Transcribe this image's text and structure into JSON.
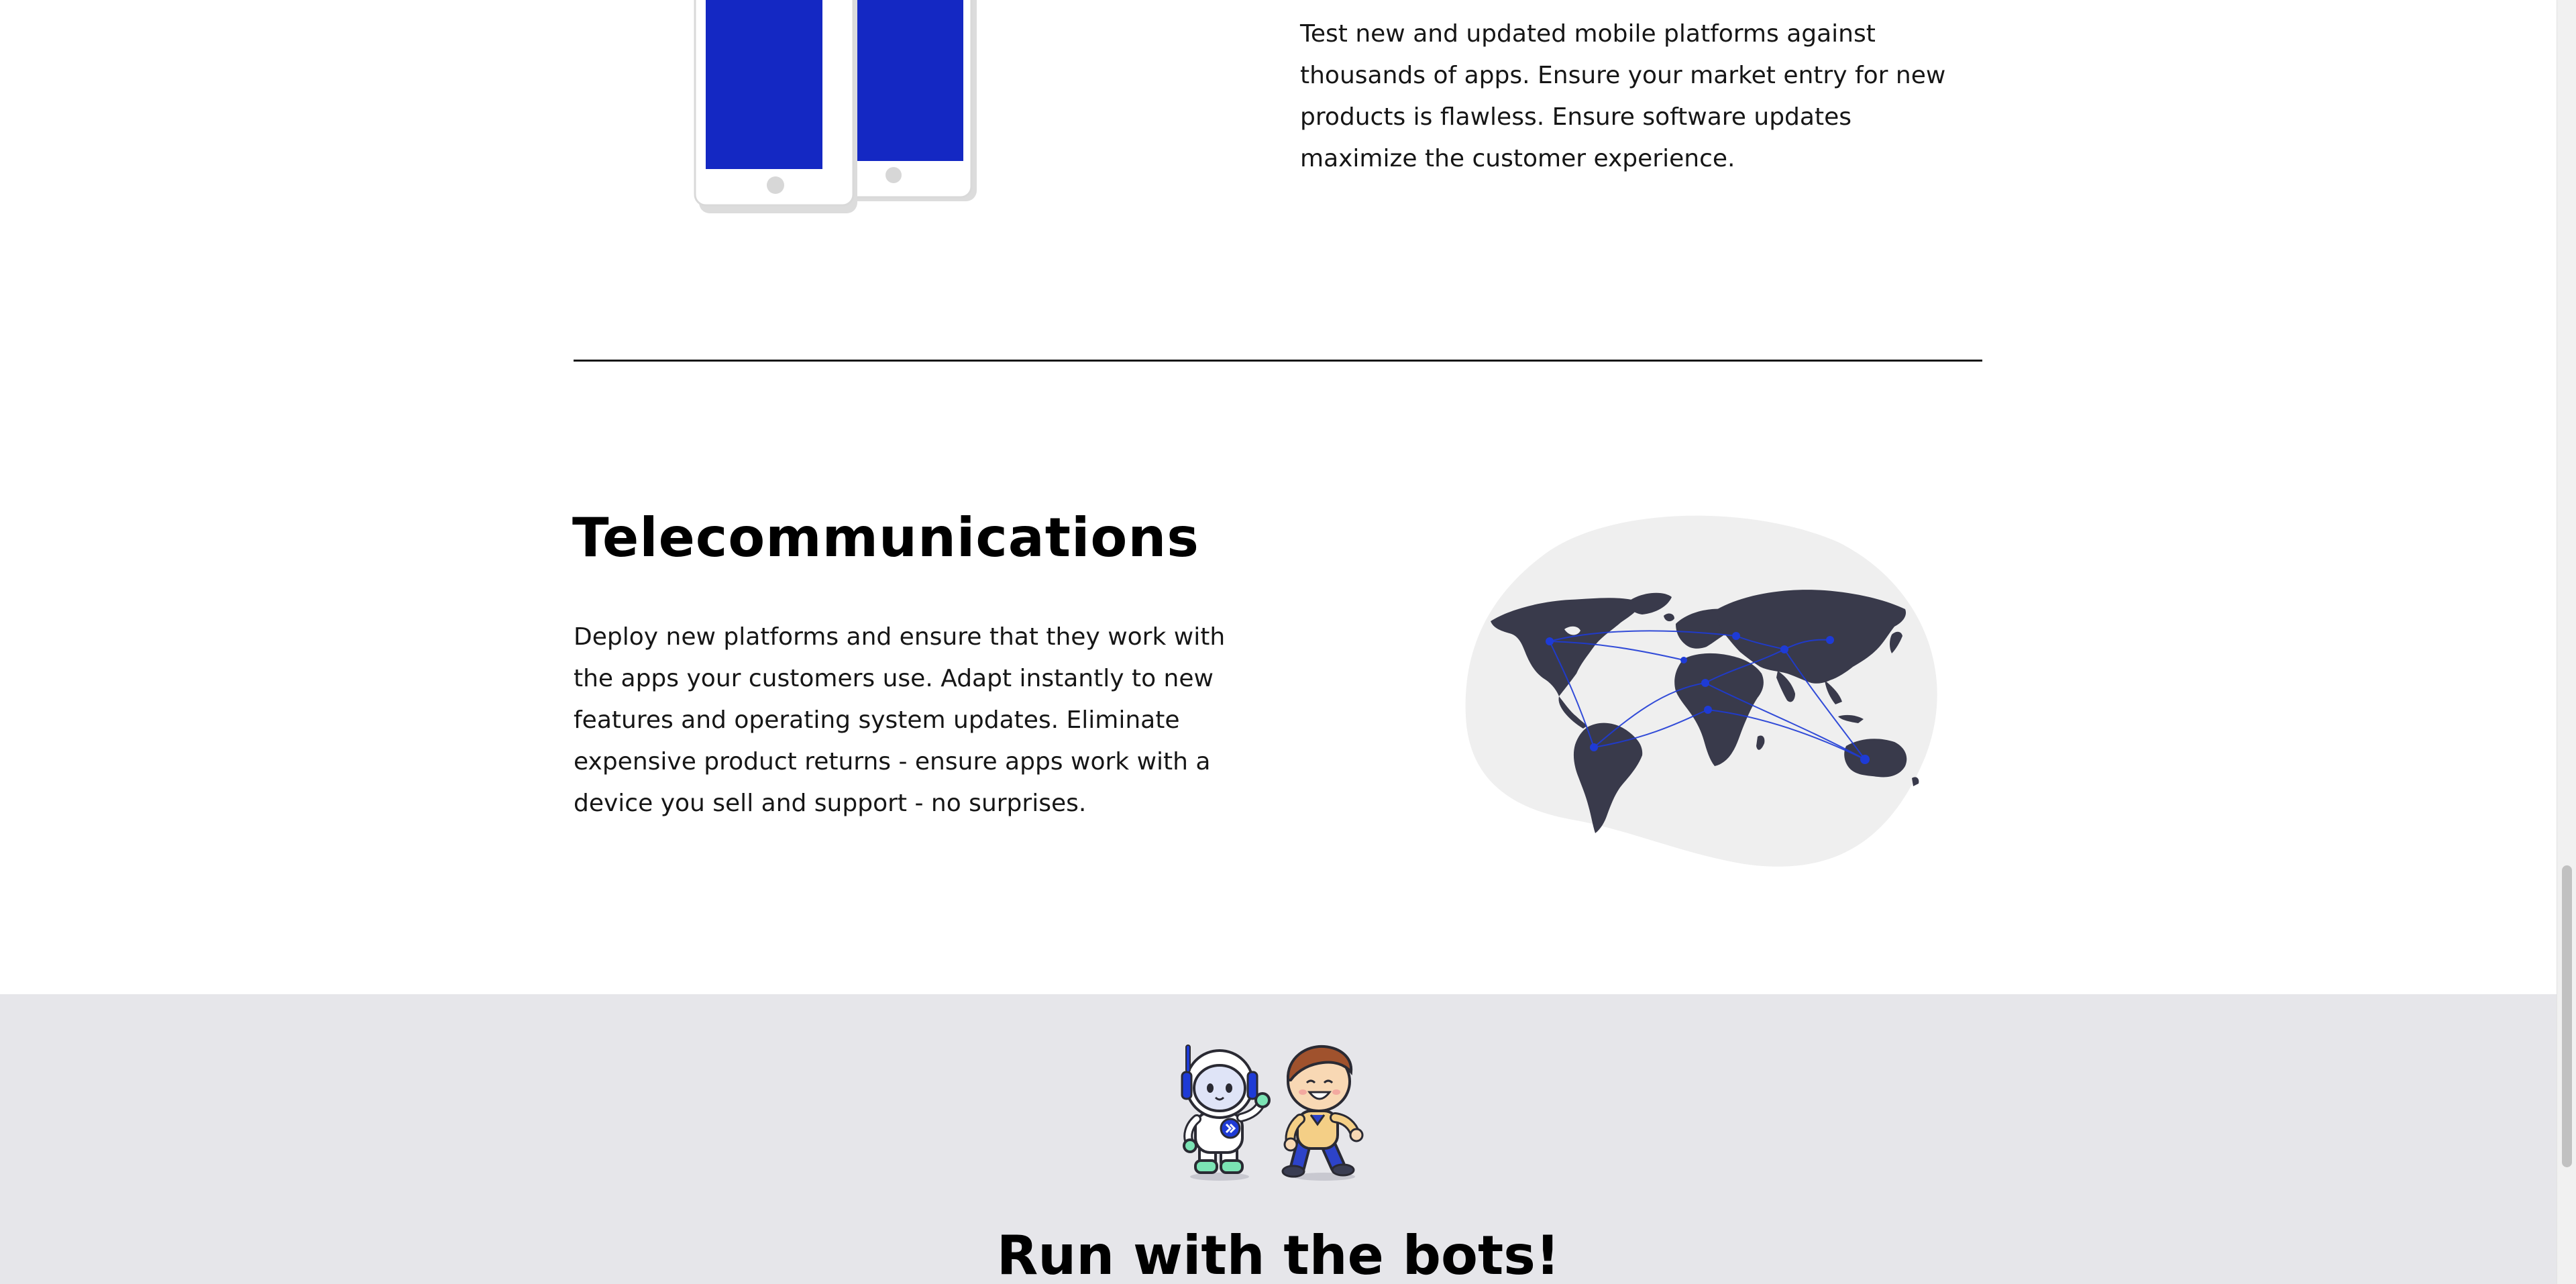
{
  "mobile_section": {
    "description": "Test new and updated mobile platforms against thousands of apps. Ensure your market entry for new products is flawless. Ensure software updates maximize the customer experience."
  },
  "telecom_section": {
    "title": "Telecommunications",
    "description": "Deploy new platforms and ensure that they work with the apps your customers use. Adapt instantly to new features and operating system updates. Eliminate expensive product returns - ensure apps work with a device you sell and support - no surprises."
  },
  "bots_section": {
    "heading": "Run with the bots!"
  },
  "colors": {
    "accent_blue": "#1428c3",
    "map_land": "#393a4b",
    "blob_gray": "#efefef",
    "band_gray": "#e6e6ea",
    "text": "#161616"
  },
  "icons": {
    "phones": "phones-illustration",
    "map": "world-map-illustration",
    "bots": "robot-and-boy-illustration"
  }
}
